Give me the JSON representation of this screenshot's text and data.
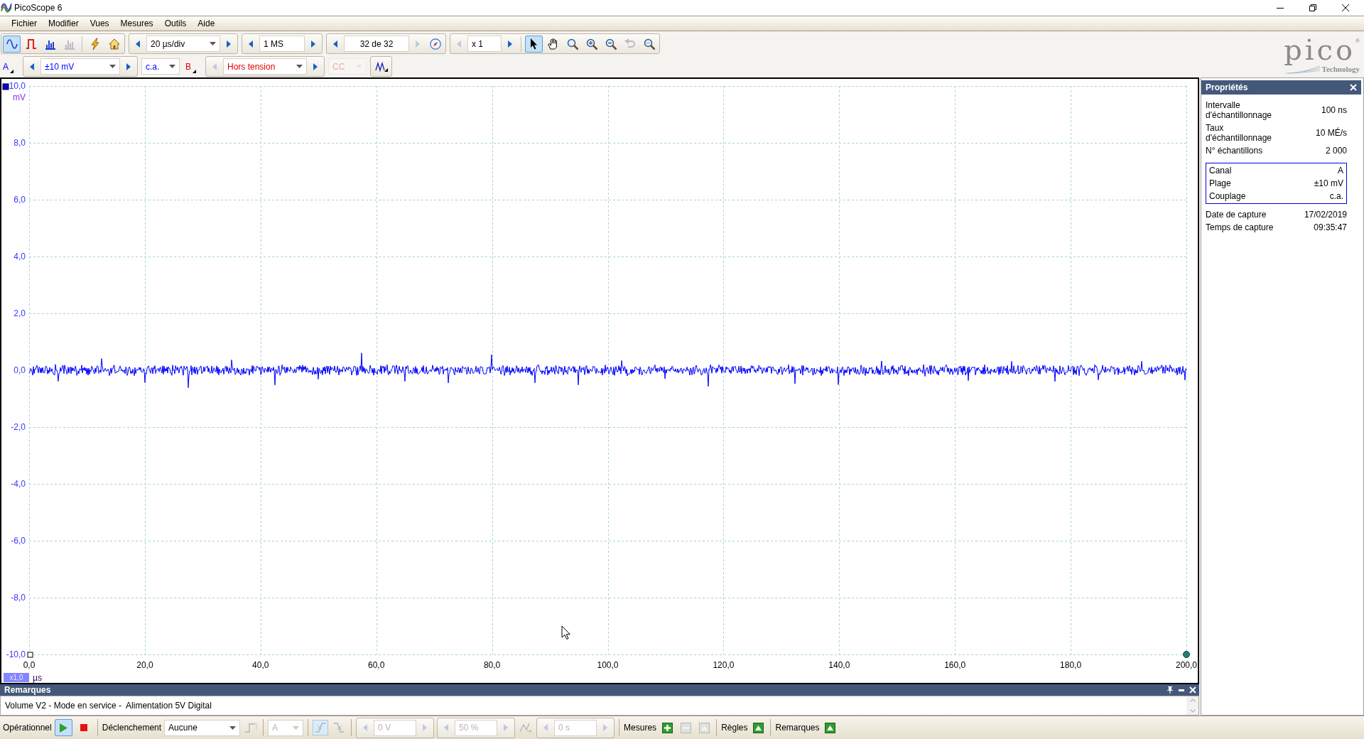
{
  "window": {
    "title": "PicoScope 6"
  },
  "menu": [
    "Fichier",
    "Modifier",
    "Vues",
    "Mesures",
    "Outils",
    "Aide"
  ],
  "logo": {
    "name": "pico",
    "mark": "®",
    "tagline": "Technology"
  },
  "toolbar": {
    "view_buttons": [
      {
        "kind": "scope",
        "selected": true,
        "disabled": false
      },
      {
        "kind": "persistence",
        "selected": false,
        "disabled": false
      },
      {
        "kind": "spectrum",
        "selected": false,
        "disabled": false
      },
      {
        "kind": "spectrum_persistence",
        "selected": false,
        "disabled": true
      }
    ],
    "setup_buttons": [
      {
        "kind": "auto_setup"
      },
      {
        "kind": "default_setup"
      }
    ],
    "timebase": {
      "value": "20 µs/div",
      "prev_disabled": false,
      "next_disabled": false
    },
    "samples": {
      "value": "1 MS",
      "prev_disabled": false,
      "next_disabled": false
    },
    "buffer": {
      "value": "32 de 32",
      "prev_disabled": false,
      "next_disabled": true
    },
    "zoom": {
      "value": "x 1",
      "prev_disabled": true,
      "next_disabled": false
    },
    "tools": [
      {
        "kind": "pointer",
        "selected": true,
        "disabled": false
      },
      {
        "kind": "hand",
        "selected": false,
        "disabled": false
      },
      {
        "kind": "zoom_area",
        "selected": false,
        "disabled": false
      },
      {
        "kind": "zoom_in",
        "selected": false,
        "disabled": false
      },
      {
        "kind": "zoom_out",
        "selected": false,
        "disabled": false
      },
      {
        "kind": "undo_zoom",
        "selected": false,
        "disabled": true
      },
      {
        "kind": "zoom_fit",
        "selected": false,
        "disabled": false
      }
    ]
  },
  "channels": [
    {
      "label": "A",
      "color": "#0000ff",
      "range": {
        "value": "±10 mV",
        "prev_disabled": false,
        "next_disabled": false
      },
      "coupling": {
        "value": "c.a.",
        "disabled": false
      }
    },
    {
      "label": "B",
      "color": "#e00000",
      "range": {
        "value": "Hors tension",
        "prev_disabled": true,
        "next_disabled": false
      },
      "coupling": {
        "value": "CC",
        "disabled": true
      }
    }
  ],
  "plot": {
    "y_ticks": [
      "10,0",
      "8,0",
      "6,0",
      "4,0",
      "2,0",
      "0,0",
      "-2,0",
      "-4,0",
      "-6,0",
      "-8,0",
      "-10,0"
    ],
    "y_unit": "mV",
    "x_ticks": [
      "0,0",
      "20,0",
      "40,0",
      "60,0",
      "80,0",
      "100,0",
      "120,0",
      "140,0",
      "160,0",
      "180,0",
      "200,0"
    ],
    "x_unit": "µs",
    "x_zoom": "x1,0"
  },
  "notes": {
    "title": "Remarques",
    "text": "Volume V2 - Mode en service -  Alimentation 5V Digital"
  },
  "properties": {
    "title": "Propriétés",
    "rows": [
      {
        "label": "Intervalle d'échantillonnage",
        "value": "100 ns"
      },
      {
        "label": "Taux d'échantillonnage",
        "value": "10 MÉ/s"
      },
      {
        "label": "N° échantillons",
        "value": "2 000"
      }
    ],
    "channel_rows": [
      {
        "label": "Canal",
        "value": "A"
      },
      {
        "label": "Plage",
        "value": "±10 mV"
      },
      {
        "label": "Couplage",
        "value": "c.a."
      }
    ],
    "capture_rows": [
      {
        "label": "Date de capture",
        "value": "17/02/2019"
      },
      {
        "label": "Temps de capture",
        "value": "09:35:47"
      }
    ]
  },
  "status_bar": {
    "run_label": "Opérationnel",
    "run_buttons": [
      {
        "kind": "run",
        "selected": true
      },
      {
        "kind": "stop",
        "selected": false
      }
    ],
    "trigger_label": "Déclenchement",
    "trigger_mode": {
      "value": "Aucune",
      "disabled": false
    },
    "trigger_type": {
      "disabled": true
    },
    "trigger_source": {
      "value": "A",
      "disabled": true
    },
    "edges": [
      {
        "kind": "rising",
        "selected": true,
        "disabled": true
      },
      {
        "kind": "falling",
        "selected": false,
        "disabled": true
      }
    ],
    "threshold": {
      "value": "0 V",
      "disabled": true
    },
    "pretrigger": {
      "value": "50 %",
      "disabled": true
    },
    "delay_toggle": {
      "disabled": true
    },
    "delay": {
      "value": "0 s",
      "disabled": true
    },
    "sections": [
      {
        "label": "Mesures",
        "buttons": [
          {
            "kind": "add",
            "disabled": false
          },
          {
            "kind": "remove",
            "disabled": true
          },
          {
            "kind": "show",
            "disabled": true
          }
        ]
      },
      {
        "label": "Règles",
        "buttons": [
          {
            "kind": "show",
            "disabled": false
          }
        ]
      },
      {
        "label": "Remarques",
        "buttons": [
          {
            "kind": "show",
            "disabled": false
          }
        ]
      }
    ]
  }
}
